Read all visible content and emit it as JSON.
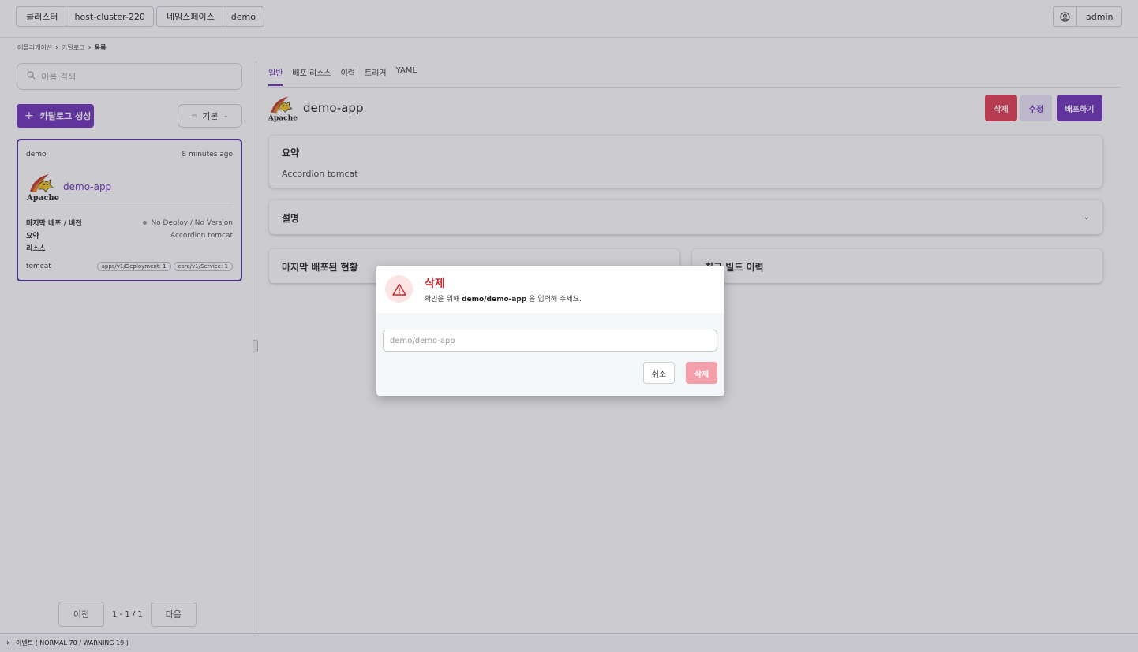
{
  "topbar": {
    "cluster_key": "클러스터",
    "cluster_value": "host-cluster-220",
    "namespace_key": "네임스페이스",
    "namespace_value": "demo",
    "user": "admin"
  },
  "breadcrumb": [
    "애플리케이션",
    "카탈로그",
    "목록"
  ],
  "sidebar": {
    "search_placeholder": "이름 검색",
    "create_label": "카탈로그 생성",
    "sort_label": "기본",
    "card": {
      "namespace": "demo",
      "time_ago": "8 minutes ago",
      "name": "demo-app",
      "last_deploy_label": "마지막 배포 / 버전",
      "last_deploy_value": "No Deploy / No Version",
      "summary_label": "요약",
      "summary_value": "Accordion tomcat",
      "resource_label": "리소스",
      "resource_name": "tomcat",
      "resource_tags": [
        "apps/v1/Deployment: 1",
        "core/v1/Service: 1"
      ]
    },
    "pager": {
      "prev": "이전",
      "info": "1 - 1 / 1",
      "next": "다음"
    }
  },
  "main": {
    "tabs": [
      "일반",
      "배포 리소스",
      "이력",
      "트리거",
      "YAML"
    ],
    "app_name": "demo-app",
    "actions": {
      "delete": "삭제",
      "edit": "수정",
      "deploy": "배포하기"
    },
    "summary_title": "요약",
    "summary_text": "Accordion tomcat",
    "description_title": "설명",
    "last_deploy_title": "마지막 배포된 현황",
    "recent_build_title": "최근 빌드 이력"
  },
  "dialog": {
    "title": "삭제",
    "message_prefix": "확인을 위해 ",
    "message_target": "demo/demo-app",
    "message_suffix": " 을 입력해 주세요.",
    "input_placeholder": "demo/demo-app",
    "cancel": "취소",
    "confirm": "삭제"
  },
  "events_bar": "이벤트 ( NORMAL 70 / WARNING 19 )",
  "colors": {
    "accent": "#6c2eb8",
    "danger": "#e23a50"
  },
  "logo_text": "Apache"
}
